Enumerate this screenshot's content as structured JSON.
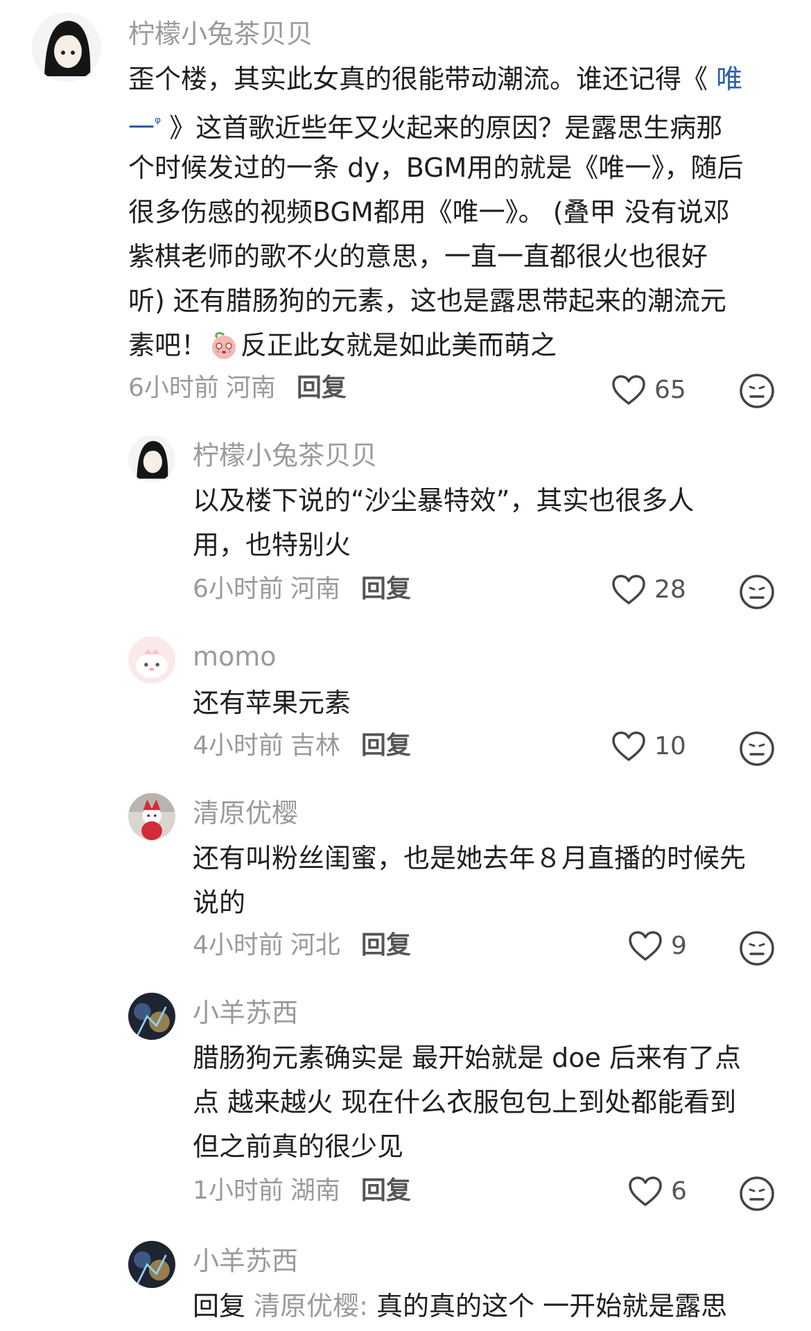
{
  "comments": [
    {
      "user": "柠檬小兔茶贝贝",
      "lines": [
        {
          "text": "歪个楼，其实此女真的很能带动潮流。谁还记得《 ",
          "keyword": "唯"
        },
        {
          "keyword_tail": "一",
          "search_mark": "ᵠ",
          "text": " 》这首歌近些年又火起来的原因？是露思生病那"
        },
        {
          "text": "个时候发过的一条 dy，BGM用的就是《唯一》，随后"
        },
        {
          "text": "很多伤感的视频BGM都用《唯一》。 (叠甲 没有说邓"
        },
        {
          "text": "紫棋老师的歌不火的意思，一直一直都很火也很好"
        },
        {
          "text": "听) 还有腊肠狗的元素，这也是露思带起来的潮流元"
        },
        {
          "text": "素吧！",
          "emoji": "crying-peach-emoji",
          "text_after": "反正此女就是如此美而萌之"
        }
      ],
      "time": "6小时前",
      "location": "河南",
      "reply_label": "回复",
      "likes": "65"
    },
    {
      "user": "柠檬小兔茶贝贝",
      "lines": [
        {
          "text": "以及楼下说的“沙尘暴特效”，其实也很多人"
        },
        {
          "text": "用，也特别火"
        }
      ],
      "time": "6小时前",
      "location": "河南",
      "reply_label": "回复",
      "likes": "28"
    },
    {
      "user": "momo",
      "lines": [
        {
          "text": "还有苹果元素"
        }
      ],
      "time": "4小时前",
      "location": "吉林",
      "reply_label": "回复",
      "likes": "10"
    },
    {
      "user": "清原优樱",
      "lines": [
        {
          "text": "还有叫粉丝闺蜜，也是她去年８月直播的时候先"
        },
        {
          "text": "说的"
        }
      ],
      "time": "4小时前",
      "location": "河北",
      "reply_label": "回复",
      "likes": "9"
    },
    {
      "user": "小羊苏西",
      "lines": [
        {
          "text": "腊肠狗元素确实是 最开始就是 doe 后来有了点"
        },
        {
          "text": "点 越来越火 现在什么衣服包包上到处都能看到"
        },
        {
          "text": "但之前真的很少见"
        }
      ],
      "time": "1小时前",
      "location": "湖南",
      "reply_label": "回复",
      "likes": "6"
    },
    {
      "user": "小羊苏西",
      "reply_prefix": "回复",
      "reply_target": "清原优樱:",
      "lines": [
        {
          "text": " 真的真的这个 一开始就是露思"
        }
      ]
    }
  ],
  "icons": {
    "like": "heart-outline-icon",
    "reaction": "neutral-face-icon"
  },
  "colors": {
    "username": "#9a9a9a",
    "body": "#1f1f1f",
    "keyword_link": "#2d5ea8"
  }
}
